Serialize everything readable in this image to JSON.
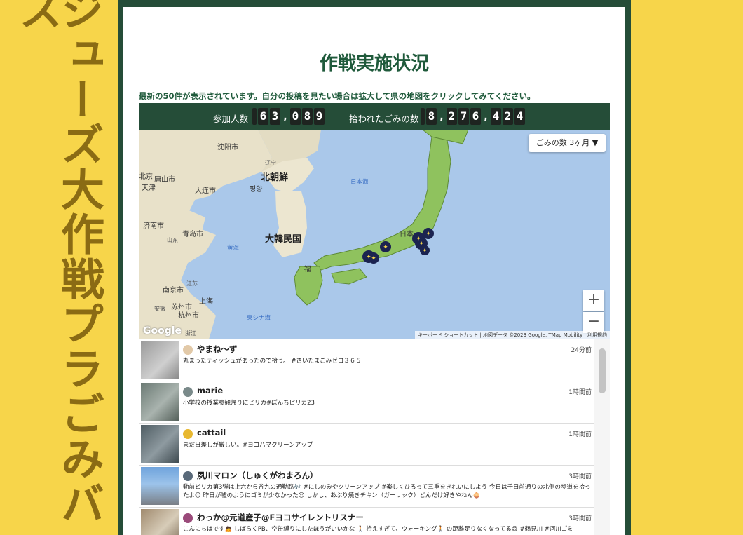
{
  "banner": {
    "text": "ジューズ大作戦プラごみバス"
  },
  "page": {
    "title": "作戦実施状況",
    "notice": "最新の50件が表示されています。自分の投稿を見たい場合は拡大して県の地図をクリックしてみてください。"
  },
  "stats": {
    "participants_label": "参加人数",
    "participants_digits": [
      "6",
      "3",
      ",",
      "0",
      "8",
      "9"
    ],
    "trash_label": "拾われたごみの数",
    "trash_digits": [
      "8",
      ",",
      "2",
      "7",
      "6",
      ",",
      "4",
      "2",
      "4"
    ]
  },
  "map": {
    "dropdown": "ごみの数 3ヶ月 ▼",
    "zoom_in": "+",
    "zoom_out": "−",
    "google": "Google",
    "attribution": "キーボード ショートカット | 地図データ ©2023 Google, TMap Mobility | 利用規約",
    "labels": {
      "shenyang": "沈阳市",
      "north_korea": "北朝鮮",
      "beijing": "北京",
      "tangshan": "唐山市",
      "tianjin": "天津",
      "dalian": "大连市",
      "pyongyang": "평양",
      "sea_of_japan": "日本海",
      "jinan": "济南市",
      "qingdao": "青岛市",
      "shandong": "山东",
      "yellow_sea": "黄海",
      "south_korea": "大韓民国",
      "nanjing": "南京市",
      "jiangsu": "江苏",
      "suzhou": "苏州市",
      "shanghai": "上海",
      "anhui": "安徽",
      "hangzhou": "杭州市",
      "east_china_sea": "東シナ海",
      "zhejiang": "浙江",
      "fukuoka": "福",
      "japan": "日本",
      "liaoning": "辽宁"
    }
  },
  "posts": [
    {
      "name": "やまね〜ず",
      "time": "24分前",
      "text": "丸まったティッシュがあったので拾う。 #さいたまごみゼロ３６５"
    },
    {
      "name": "marie",
      "time": "1時間前",
      "text": "小学校の授業参観帰りにピリカ#ぽんちピリカ23"
    },
    {
      "name": "cattail",
      "time": "1時間前",
      "text": "まだ日差しが厳しい。#ヨコハマクリーンアップ"
    },
    {
      "name": "夙川マロン（しゅくがわまろん）",
      "time": "3時間前",
      "text": "動前ピリカ第3弾は上六から谷九の通勤路🎶 #にしのみやクリーンアップ #楽しくひろって三重をきれいにしよう 今日は千日前通りの北側の歩道を拾ったよ😊 昨日が嘘のようにゴミが少なかった😌 しかし、あぶり焼きチキン（ガーリック）どんだけ好きやねん🧅"
    },
    {
      "name": "わっか@元道産子@Fヨコサイレントリスナー",
      "time": "3時間前",
      "text": "こんにちはです🙇 しばらくPB、空缶縛りにしたほうがいいかな 🚶 拾えすぎて、ウォーキング🚶 の距離足りなくなってる😅 #鶴見川 #河川ゴミ"
    }
  ],
  "colors": {
    "background_yellow": "#f7d54a",
    "frame_green": "#254d38",
    "title_green": "#1f5a3b",
    "marker_navy": "#1b2350",
    "land_japan": "#8fc25e"
  }
}
